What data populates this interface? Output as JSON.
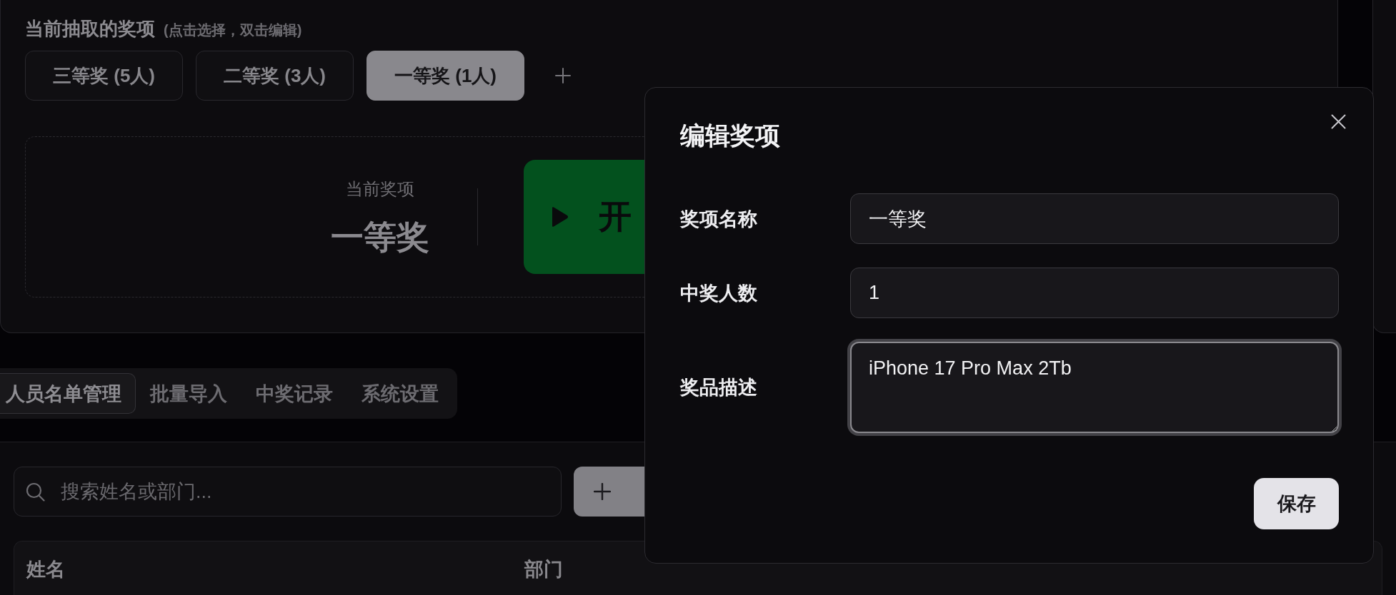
{
  "prize_panel": {
    "title": "当前抽取的奖项",
    "hint": "(点击选择，双击编辑)",
    "prizes": [
      {
        "label": "三等奖 (5人)",
        "selected": false
      },
      {
        "label": "二等奖 (3人)",
        "selected": false
      },
      {
        "label": "一等奖 (1人)",
        "selected": true
      }
    ]
  },
  "current_prize": {
    "label": "当前奖项",
    "value": "一等奖"
  },
  "start_button": {
    "label": "开"
  },
  "tabs": [
    {
      "label": "人员名单管理",
      "selected": true
    },
    {
      "label": "批量导入",
      "selected": false
    },
    {
      "label": "中奖记录",
      "selected": false
    },
    {
      "label": "系统设置",
      "selected": false
    }
  ],
  "search": {
    "placeholder": "搜索姓名或部门..."
  },
  "table": {
    "columns": [
      "姓名",
      "部门"
    ]
  },
  "dialog": {
    "title": "编辑奖项",
    "fields": [
      {
        "label": "奖项名称",
        "kind": "input",
        "value": "一等奖",
        "focused": false
      },
      {
        "label": "中奖人数",
        "kind": "input",
        "value": "1",
        "focused": false
      },
      {
        "label": "奖品描述",
        "kind": "textarea",
        "value": "iPhone 17 Pro Max 2Tb",
        "focused": true
      }
    ],
    "save_label": "保存"
  }
}
